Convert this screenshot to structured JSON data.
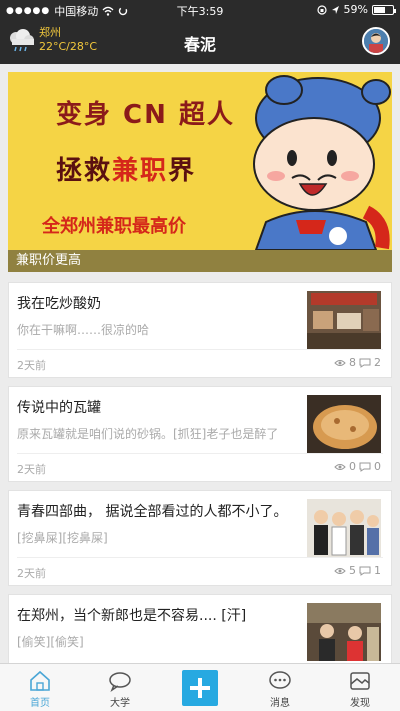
{
  "status_bar": {
    "carrier": "中国移动",
    "time": "下午3:59",
    "battery": "59%",
    "battery_level": 0.59
  },
  "header": {
    "title": "春泥",
    "weather": {
      "city": "郑州",
      "temp": "22°C/28°C",
      "icon": "cloud-rain-icon"
    }
  },
  "banner": {
    "line1": "变身 CN 超人",
    "line2_prefix": "拯救",
    "line2_highlight": "兼职",
    "line2_suffix": "界",
    "line3": "全郑州兼职最高价",
    "caption": "兼职价更高"
  },
  "feed": [
    {
      "title": "我在吃炒酸奶",
      "subtitle": "你在干嘛啊……很凉的哈",
      "time": "2天前",
      "views": "8",
      "comments": "2"
    },
    {
      "title": "传说中的瓦罐",
      "subtitle": "原来瓦罐就是咱们说的砂锅。[抓狂]老子也是醉了",
      "time": "2天前",
      "views": "0",
      "comments": "0"
    },
    {
      "title": "青春四部曲， 据说全部看过的人都不小了。",
      "subtitle": "[挖鼻屎][挖鼻屎]",
      "time": "2天前",
      "views": "5",
      "comments": "1"
    },
    {
      "title": "在郑州，当个新郎也是不容易.... [汗]",
      "subtitle": "[偷笑][偷笑]",
      "time": "",
      "views": "",
      "comments": ""
    }
  ],
  "tabbar": {
    "items": [
      {
        "label": "首页",
        "icon": "home-icon",
        "active": true
      },
      {
        "label": "大学",
        "icon": "chat-bubble-icon",
        "active": false
      },
      {
        "label": "",
        "icon": "plus-icon",
        "active": false
      },
      {
        "label": "消息",
        "icon": "message-icon",
        "active": false
      },
      {
        "label": "发现",
        "icon": "discover-icon",
        "active": false
      }
    ]
  },
  "colors": {
    "accent": "#27a9e1",
    "header_bg": "#2b2b2b",
    "weather_text": "#f2c83c",
    "banner_bg": "#f5d445"
  }
}
